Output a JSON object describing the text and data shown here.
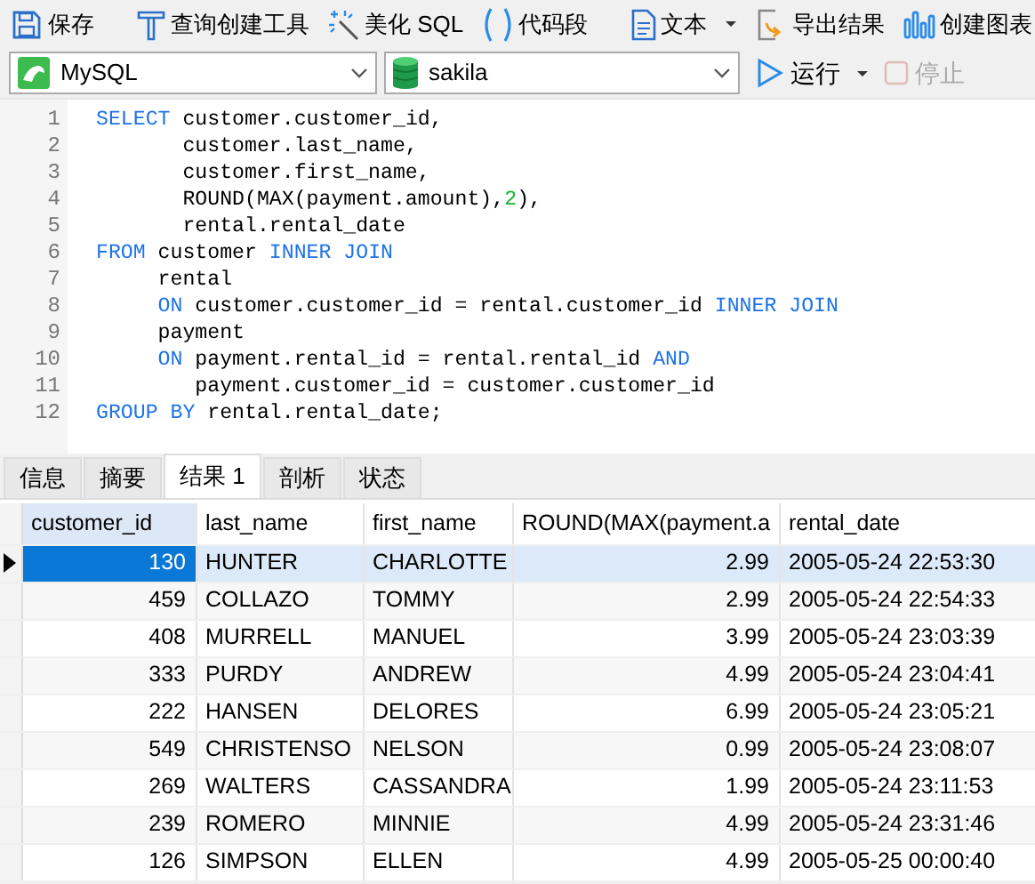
{
  "toolbar": [
    {
      "kind": "save",
      "label": "保存"
    },
    {
      "kind": "separator"
    },
    {
      "kind": "query-builder",
      "label": "查询创建工具"
    },
    {
      "kind": "beautify",
      "label": "美化 SQL"
    },
    {
      "kind": "snippet",
      "label": "代码段"
    },
    {
      "kind": "separator"
    },
    {
      "kind": "text-menu",
      "label": "文本"
    },
    {
      "kind": "export",
      "label": "导出结果"
    },
    {
      "kind": "chart",
      "label": "创建图表"
    }
  ],
  "connection": {
    "value": "MySQL"
  },
  "database": {
    "value": "sakila"
  },
  "run": {
    "label": "运行"
  },
  "stop": {
    "label": "停止",
    "disabled": true
  },
  "editor": {
    "lines": [
      {
        "number": "1",
        "tokens": [
          {
            "kind": "keyword",
            "text": "SELECT"
          },
          {
            "kind": "plain",
            "text": " customer.customer_id,"
          }
        ]
      },
      {
        "number": "2",
        "tokens": [
          {
            "kind": "plain",
            "text": "       customer.last_name,"
          }
        ]
      },
      {
        "number": "3",
        "tokens": [
          {
            "kind": "plain",
            "text": "       customer.first_name,"
          }
        ]
      },
      {
        "number": "4",
        "tokens": [
          {
            "kind": "plain",
            "text": "       ROUND(MAX(payment.amount),"
          },
          {
            "kind": "number",
            "text": "2"
          },
          {
            "kind": "plain",
            "text": "),"
          }
        ]
      },
      {
        "number": "5",
        "tokens": [
          {
            "kind": "plain",
            "text": "       rental.rental_date"
          }
        ]
      },
      {
        "number": "6",
        "tokens": [
          {
            "kind": "keyword",
            "text": "FROM"
          },
          {
            "kind": "plain",
            "text": " customer "
          },
          {
            "kind": "keyword",
            "text": "INNER JOIN"
          }
        ]
      },
      {
        "number": "7",
        "tokens": [
          {
            "kind": "plain",
            "text": "     rental"
          }
        ]
      },
      {
        "number": "8",
        "tokens": [
          {
            "kind": "keyword",
            "text": "     ON"
          },
          {
            "kind": "plain",
            "text": " customer.customer_id = rental.customer_id "
          },
          {
            "kind": "keyword",
            "text": "INNER JOIN"
          }
        ]
      },
      {
        "number": "9",
        "tokens": [
          {
            "kind": "plain",
            "text": "     payment"
          }
        ]
      },
      {
        "number": "10",
        "tokens": [
          {
            "kind": "keyword",
            "text": "     ON"
          },
          {
            "kind": "plain",
            "text": " payment.rental_id = rental.rental_id "
          },
          {
            "kind": "keyword",
            "text": "AND"
          }
        ]
      },
      {
        "number": "11",
        "tokens": [
          {
            "kind": "plain",
            "text": "        payment.customer_id = customer.customer_id"
          }
        ]
      },
      {
        "number": "12",
        "tokens": [
          {
            "kind": "keyword",
            "text": "GROUP BY"
          },
          {
            "kind": "plain",
            "text": " rental.rental_date;"
          }
        ]
      }
    ]
  },
  "result_tabs": [
    {
      "label": "信息",
      "selected": false
    },
    {
      "label": "摘要",
      "selected": false
    },
    {
      "label": "结果 1",
      "selected": true
    },
    {
      "label": "剖析",
      "selected": false
    },
    {
      "label": "状态",
      "selected": false
    }
  ],
  "table": {
    "columns": [
      {
        "label": "customer_id"
      },
      {
        "label": "last_name"
      },
      {
        "label": "first_name"
      },
      {
        "label": "ROUND(MAX(payment.a"
      },
      {
        "label": "rental_date"
      }
    ],
    "rows": [
      {
        "selected": true,
        "cells": [
          "130",
          "HUNTER",
          "CHARLOTTE",
          "2.99",
          "2005-05-24 22:53:30"
        ]
      },
      {
        "selected": false,
        "cells": [
          "459",
          "COLLAZO",
          "TOMMY",
          "2.99",
          "2005-05-24 22:54:33"
        ]
      },
      {
        "selected": false,
        "cells": [
          "408",
          "MURRELL",
          "MANUEL",
          "3.99",
          "2005-05-24 23:03:39"
        ]
      },
      {
        "selected": false,
        "cells": [
          "333",
          "PURDY",
          "ANDREW",
          "4.99",
          "2005-05-24 23:04:41"
        ]
      },
      {
        "selected": false,
        "cells": [
          "222",
          "HANSEN",
          "DELORES",
          "6.99",
          "2005-05-24 23:05:21"
        ]
      },
      {
        "selected": false,
        "cells": [
          "549",
          "CHRISTENSO",
          "NELSON",
          "0.99",
          "2005-05-24 23:08:07"
        ]
      },
      {
        "selected": false,
        "cells": [
          "269",
          "WALTERS",
          "CASSANDRA",
          "1.99",
          "2005-05-24 23:11:53"
        ]
      },
      {
        "selected": false,
        "cells": [
          "239",
          "ROMERO",
          "MINNIE",
          "4.99",
          "2005-05-24 23:31:46"
        ]
      },
      {
        "selected": false,
        "cells": [
          "126",
          "SIMPSON",
          "ELLEN",
          "4.99",
          "2005-05-25 00:00:40"
        ]
      }
    ]
  }
}
